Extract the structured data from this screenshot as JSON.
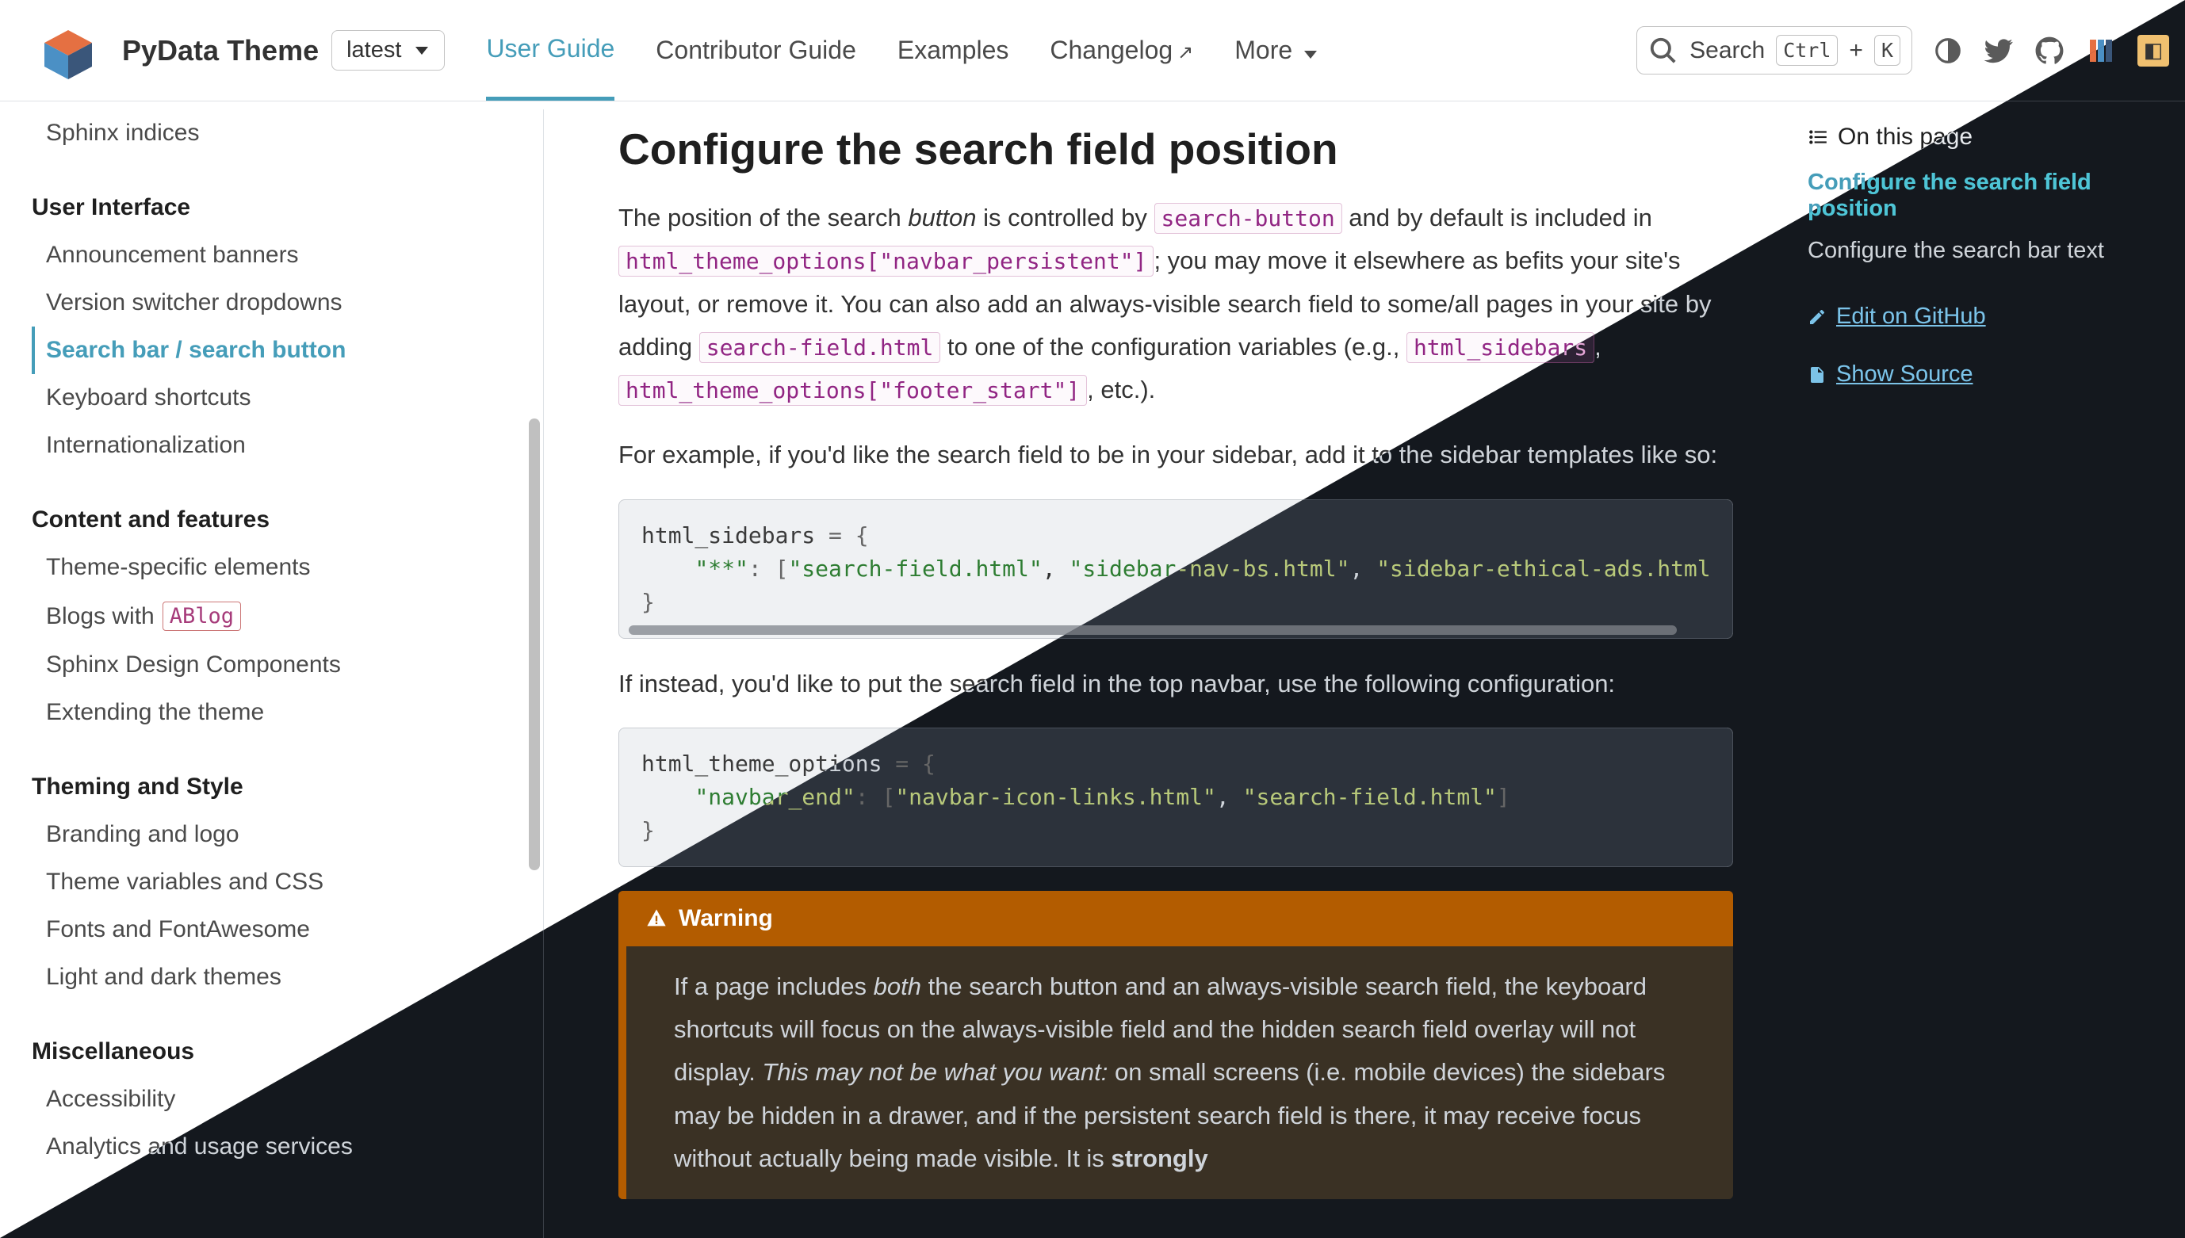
{
  "header": {
    "site_title": "PyData Theme",
    "version_label": "latest",
    "nav": [
      {
        "label": "User Guide",
        "active": true,
        "ext": false
      },
      {
        "label": "Contributor Guide",
        "active": false,
        "ext": false
      },
      {
        "label": "Examples",
        "active": false,
        "ext": false
      },
      {
        "label": "Changelog",
        "active": false,
        "ext": true
      },
      {
        "label": "More",
        "active": false,
        "dropdown": true
      }
    ],
    "search_label": "Search",
    "kbd_ctrl": "Ctrl",
    "kbd_k": "K"
  },
  "sidebar_left": {
    "top_item": "Sphinx indices",
    "sections": [
      {
        "heading": "User Interface",
        "items": [
          {
            "label": "Announcement banners"
          },
          {
            "label": "Version switcher dropdowns"
          },
          {
            "label": "Search bar / search button",
            "active": true
          },
          {
            "label": "Keyboard shortcuts"
          },
          {
            "label": "Internationalization"
          }
        ]
      },
      {
        "heading": "Content and features",
        "items": [
          {
            "label": "Theme-specific elements"
          },
          {
            "label_pre": "Blogs with ",
            "chip": "ABlog"
          },
          {
            "label": "Sphinx Design Components"
          },
          {
            "label": "Extending the theme"
          }
        ]
      },
      {
        "heading": "Theming and Style",
        "items": [
          {
            "label": "Branding and logo"
          },
          {
            "label": "Theme variables and CSS"
          },
          {
            "label": "Fonts and FontAwesome"
          },
          {
            "label": "Light and dark themes"
          }
        ]
      },
      {
        "heading": "Miscellaneous",
        "items": [
          {
            "label": "Accessibility"
          },
          {
            "label": "Analytics and usage services"
          }
        ]
      }
    ]
  },
  "main": {
    "title": "Configure the search field position",
    "p1_a": "The position of the search ",
    "p1_em1": "button",
    "p1_b": " is controlled by ",
    "p1_lit1": "search-button",
    "p1_c": " and by default is included in ",
    "p1_lit2": "html_theme_options[\"navbar_persistent\"]",
    "p1_d": "; you may move it elsewhere as befits your site's layout, or remove it. You can also add an always-visible search field to some/all pages in your site by adding ",
    "p1_lit3": "search-field.html",
    "p1_e": " to one of the configuration variables (e.g., ",
    "p1_lit4": "html_sidebars",
    "p1_f": ", ",
    "p1_lit5": "html_theme_options[\"footer_start\"]",
    "p1_g": ", etc.).",
    "p2": "For example, if you'd like the search field to be in your sidebar, add it to the sidebar templates like so:",
    "code1_n1": "html_sidebars",
    "code1_op1": " = {",
    "code1_k1": "\"**\"",
    "code1_op2": ": [",
    "code1_s1": "\"search-field.html\"",
    "code1_c1": ", ",
    "code1_s2": "\"sidebar-nav-bs.html\"",
    "code1_c2": ", ",
    "code1_s3": "\"sidebar-ethical-ads.html",
    "code1_close": "}",
    "p3": "If instead, you'd like to put the search field in the top navbar, use the following configuration:",
    "code2_n1": "html_theme_options",
    "code2_op1": " = {",
    "code2_k1": "\"navbar_end\"",
    "code2_op2": ": [",
    "code2_s1": "\"navbar-icon-links.html\"",
    "code2_c1": ", ",
    "code2_s2": "\"search-field.html\"",
    "code2_op3": "]",
    "code2_close": "}",
    "warn_title": "Warning",
    "warn_a": "If a page includes ",
    "warn_em1": "both",
    "warn_b": " the search button and an always-visible search field, the keyboard shortcuts will focus on the always-visible field and the hidden search field overlay will not display. ",
    "warn_em2": "This may not be what you want:",
    "warn_c": " on small screens (i.e. mobile devices) the sidebars may be hidden in a drawer, and if the persistent search field is there, it may receive focus without actually being made visible. It is ",
    "warn_strong": "strongly"
  },
  "sidebar_right": {
    "heading": "On this page",
    "items": [
      {
        "label": "Configure the search field position",
        "active": true
      },
      {
        "label": "Configure the search bar text"
      }
    ],
    "edit_label": "Edit on GitHub",
    "source_label": "Show Source"
  }
}
